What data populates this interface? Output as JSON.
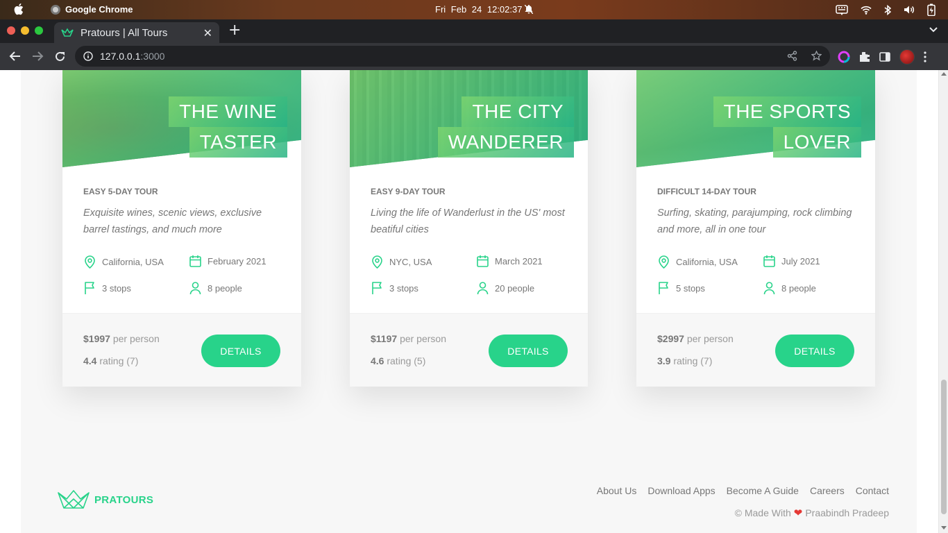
{
  "os": {
    "app_name": "Google Chrome",
    "clock": "Fri Feb 24  12:02:37"
  },
  "browser": {
    "tab_title": "Pratours | All Tours",
    "url_host": "127.0.0.1",
    "url_port": ":3000"
  },
  "tours": [
    {
      "title_line1": "THE WINE",
      "title_line2": "TASTER",
      "subtitle": "EASY 5-DAY TOUR",
      "description": "Exquisite wines, scenic views, exclusive barrel tastings, and much more",
      "location": "California, USA",
      "date": "February 2021",
      "stops": "3 stops",
      "people": "8 people",
      "price": "$1997",
      "price_suffix": "per person",
      "rating": "4.4",
      "rating_suffix": "rating (7)",
      "button_label": "DETAILS"
    },
    {
      "title_line1": "THE CITY",
      "title_line2": "WANDERER",
      "subtitle": "EASY 9-DAY TOUR",
      "description": "Living the life of Wanderlust in the US' most beatiful cities",
      "location": "NYC, USA",
      "date": "March 2021",
      "stops": "3 stops",
      "people": "20 people",
      "price": "$1197",
      "price_suffix": "per person",
      "rating": "4.6",
      "rating_suffix": "rating (5)",
      "button_label": "DETAILS"
    },
    {
      "title_line1": "THE SPORTS",
      "title_line2": "LOVER",
      "subtitle": "DIFFICULT 14-DAY TOUR",
      "description": "Surfing, skating, parajumping, rock climbing and more, all in one tour",
      "location": "California, USA",
      "date": "July 2021",
      "stops": "5 stops",
      "people": "8 people",
      "price": "$2997",
      "price_suffix": "per person",
      "rating": "3.9",
      "rating_suffix": "rating (7)",
      "button_label": "DETAILS"
    }
  ],
  "footer": {
    "logo_text": "PRATOURS",
    "nav": [
      "About Us",
      "Download Apps",
      "Become A Guide",
      "Careers",
      "Contact"
    ],
    "copyright_prefix": "© Made With",
    "copyright_author": "Praabindh Pradeep"
  },
  "colors": {
    "accent": "#28d38a",
    "accent_light": "#7dd56f",
    "text_muted": "#777777"
  }
}
